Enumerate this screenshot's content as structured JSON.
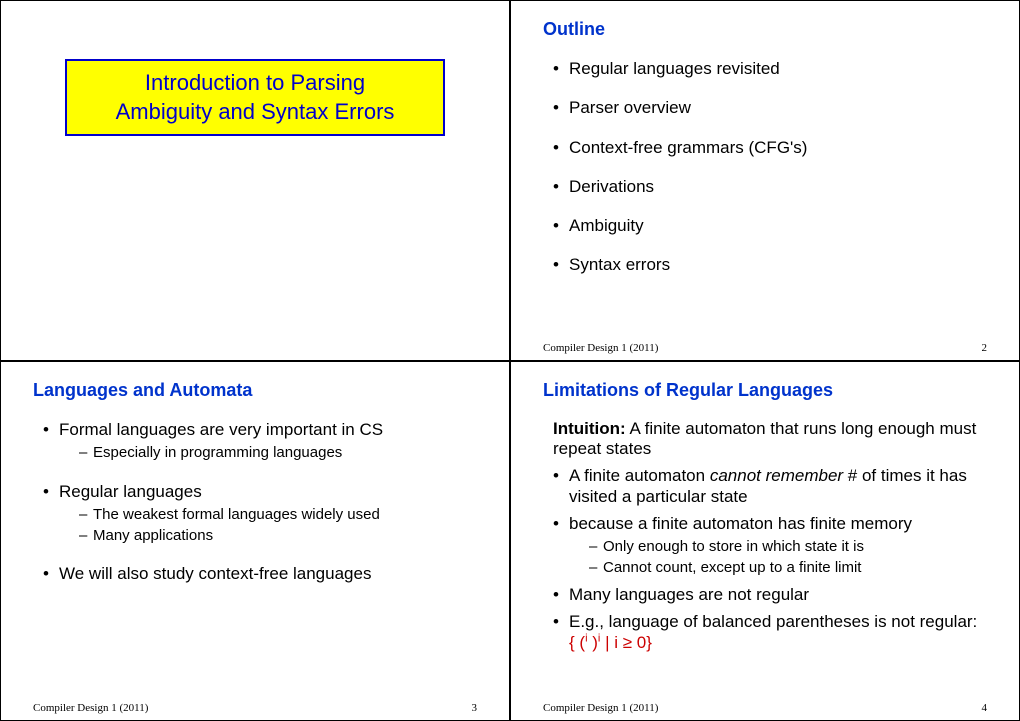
{
  "footer_course": "Compiler Design 1 (2011)",
  "slide1": {
    "title_line1": "Introduction to Parsing",
    "title_line2": "Ambiguity and Syntax Errors"
  },
  "slide2": {
    "title": "Outline",
    "bullets": [
      "Regular languages revisited",
      "Parser overview",
      "Context-free grammars (CFG's)",
      "Derivations",
      "Ambiguity",
      "Syntax errors"
    ],
    "page": "2"
  },
  "slide3": {
    "title": "Languages and Automata",
    "b1": "Formal languages are very important in CS",
    "b1s1": "Especially in programming languages",
    "b2": "Regular languages",
    "b2s1": "The weakest formal languages widely used",
    "b2s2": "Many applications",
    "b3": "We will also study context-free languages",
    "page": "3"
  },
  "slide4": {
    "title": "Limitations of Regular Languages",
    "intuition_label": "Intuition:",
    "intuition_text": " A finite automaton that runs long enough must repeat states",
    "b1a": "A finite automaton ",
    "b1b_italic": "cannot remember ",
    "b1c": "# of times it has visited a particular state",
    "b2": "because a finite automaton has finite memory",
    "b2s1": "Only enough to store in which state it is",
    "b2s2": "Cannot count, except up to a finite limit",
    "b3": "Many languages are not regular",
    "b4a": "E.g., language of balanced parentheses is not regular: ",
    "b4b_red": "{ (",
    "b4c_sup": "i",
    "b4d_red": " )",
    "b4e_sup": "i",
    "b4f_red": " | i ≥ 0}",
    "page": "4"
  }
}
